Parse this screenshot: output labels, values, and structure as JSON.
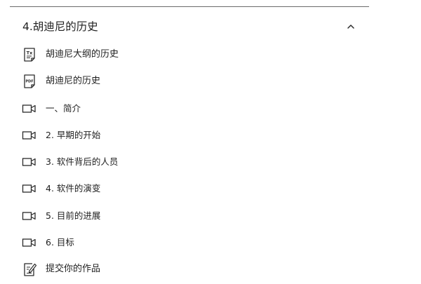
{
  "section": {
    "title": "4.胡迪尼的历史",
    "expanded": true,
    "toggle_icon": "chevron-up-icon"
  },
  "items": [
    {
      "type": "text-document",
      "icon": "text-document-icon",
      "label": "胡迪尼大纲的历史"
    },
    {
      "type": "pdf",
      "icon": "pdf-file-icon",
      "label": "胡迪尼的历史"
    },
    {
      "type": "video",
      "icon": "video-icon",
      "label": "一、简介"
    },
    {
      "type": "video",
      "icon": "video-icon",
      "label": "2. 早期的开始"
    },
    {
      "type": "video",
      "icon": "video-icon",
      "label": "3. 软件背后的人员"
    },
    {
      "type": "video",
      "icon": "video-icon",
      "label": "4. 软件的演变"
    },
    {
      "type": "video",
      "icon": "video-icon",
      "label": "5. 目前的进展"
    },
    {
      "type": "video",
      "icon": "video-icon",
      "label": "6. 目标"
    },
    {
      "type": "assignment",
      "icon": "assignment-icon",
      "label": "提交你的作品"
    }
  ],
  "icon_glyphs": {
    "text_document": "Tx",
    "pdf": "PDF"
  }
}
